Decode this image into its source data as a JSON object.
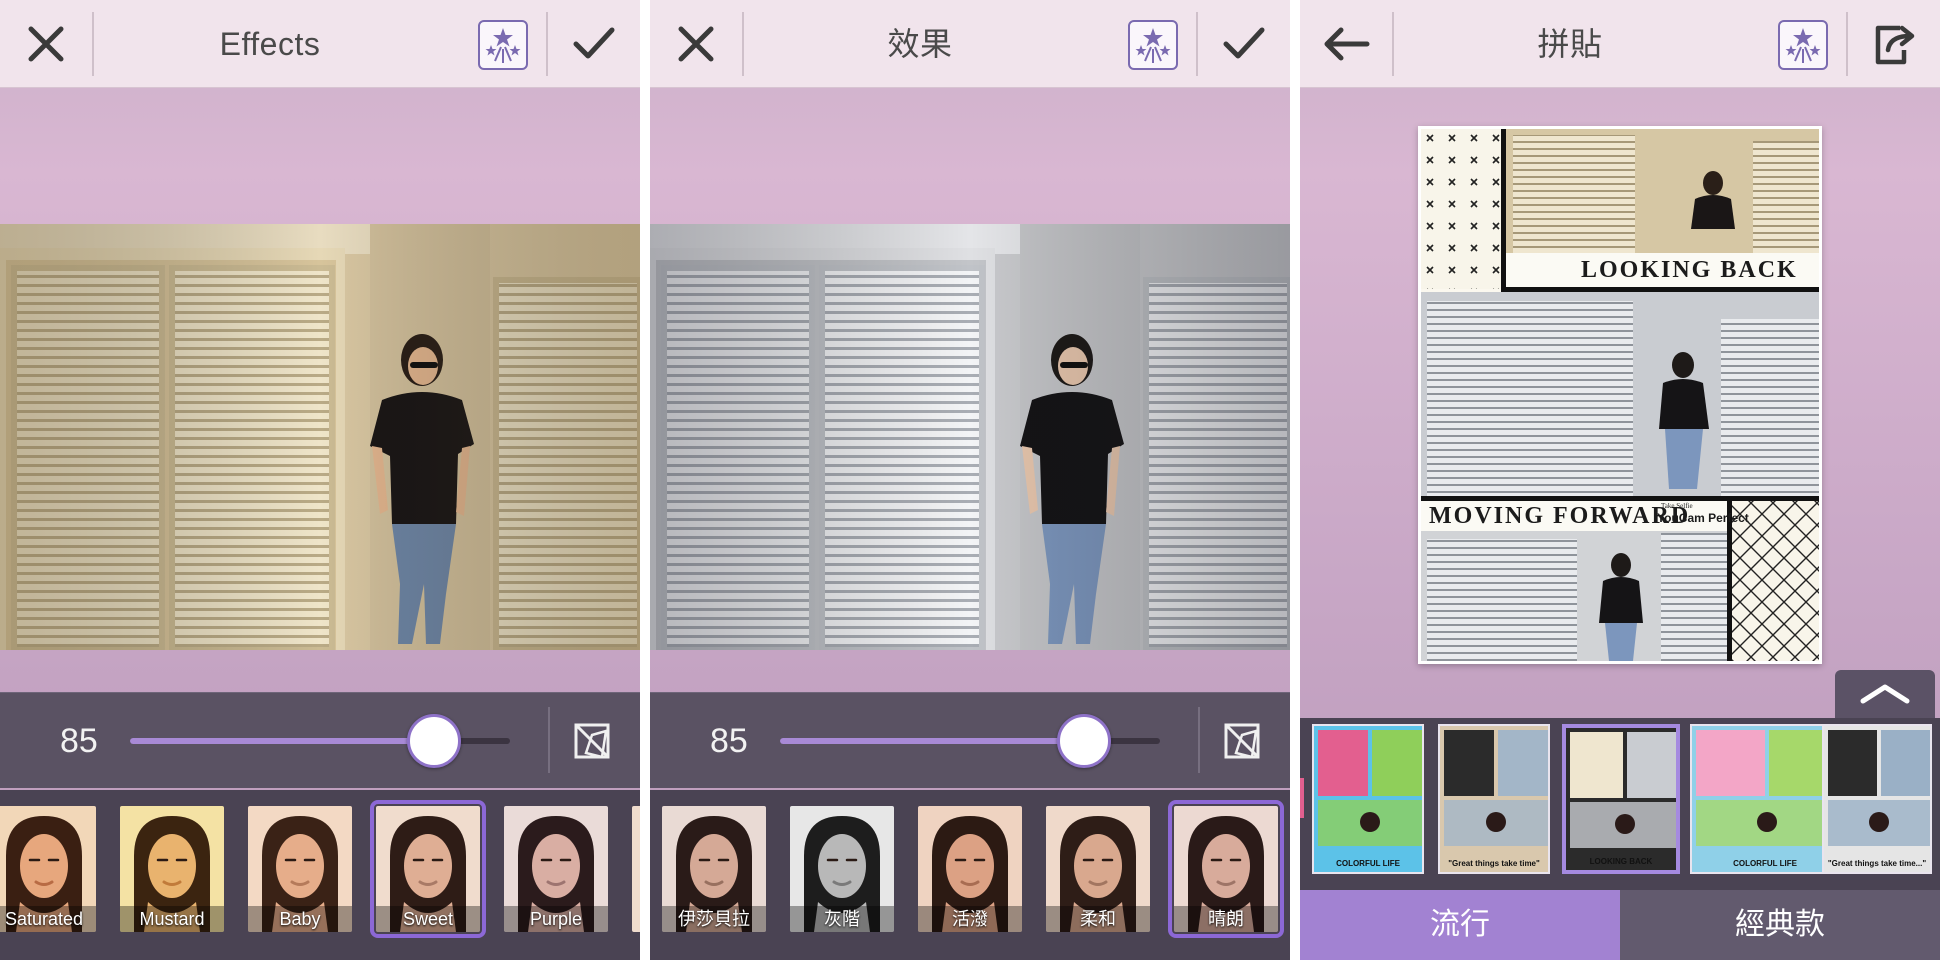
{
  "panels": [
    {
      "title": "Effects",
      "left_icon": "close-icon",
      "right_icon": "checkmark-icon",
      "slider": {
        "value": "85",
        "level": 0.8
      },
      "effects": [
        {
          "label": "Saturated",
          "selected": false,
          "tone": "warm"
        },
        {
          "label": "Mustard",
          "selected": false,
          "tone": "mustard"
        },
        {
          "label": "Baby",
          "selected": false,
          "tone": "baby"
        },
        {
          "label": "Sweet",
          "selected": true,
          "tone": "sweet"
        },
        {
          "label": "Purple",
          "selected": false,
          "tone": "purple"
        }
      ]
    },
    {
      "title": "效果",
      "left_icon": "close-icon",
      "right_icon": "checkmark-icon",
      "slider": {
        "value": "85",
        "level": 0.8
      },
      "effects": [
        {
          "label": "伊莎貝拉",
          "selected": false,
          "tone": "isabella"
        },
        {
          "label": "灰階",
          "selected": false,
          "tone": "gray"
        },
        {
          "label": "活潑",
          "selected": false,
          "tone": "lively"
        },
        {
          "label": "柔和",
          "selected": false,
          "tone": "soft"
        },
        {
          "label": "晴朗",
          "selected": true,
          "tone": "clear"
        }
      ]
    },
    {
      "title": "拼貼",
      "left_icon": "back-arrow-icon",
      "right_icon": "share-export-icon",
      "collage": {
        "banner_top": "LOOKING  BACK",
        "banner_bottom": "MOVING  FORWARD",
        "brand_small": "YouCam Perfect",
        "brand_tiny": "Take Selfie"
      },
      "templates": [
        {
          "caption": "COLORFUL LIFE",
          "selected": false
        },
        {
          "caption": "\"Great things take time\"",
          "selected": false
        },
        {
          "caption": "LOOKING BACK",
          "selected": true
        },
        {
          "caption": "COLORFUL LIFE",
          "selected": false
        },
        {
          "caption": "\"Great things take time...\"",
          "selected": false
        }
      ],
      "tabs": [
        {
          "label": "流行",
          "active": true
        },
        {
          "label": "經典款",
          "active": false
        }
      ]
    }
  ],
  "colors": {
    "accent": "#8c68d6",
    "topbar": "#f1e4ec",
    "controls": "#5a5263",
    "strip": "#4a4353"
  }
}
